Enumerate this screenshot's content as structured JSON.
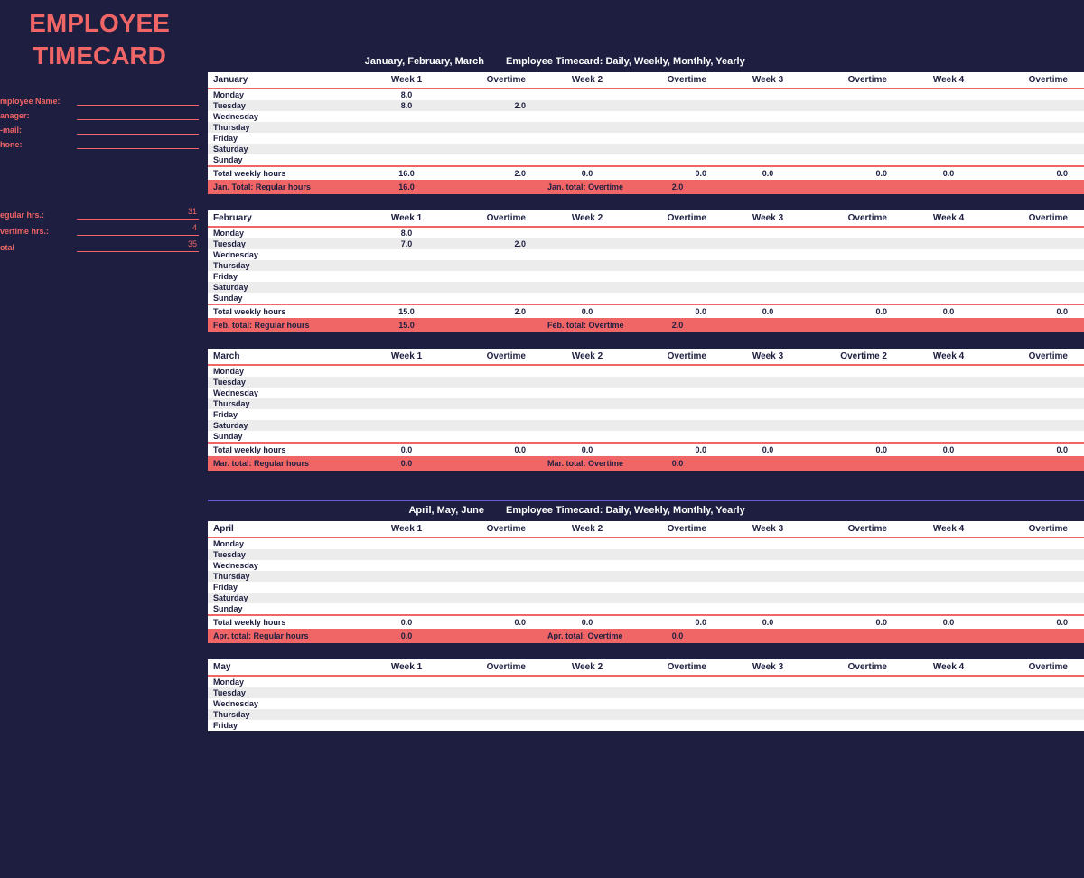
{
  "title": {
    "line1": "EMPLOYEE",
    "line2": "TIMECARD"
  },
  "sidebar": {
    "fields": [
      {
        "label": "mployee Name:"
      },
      {
        "label": "anager:"
      },
      {
        "label": "-mail:"
      },
      {
        "label": "hone:"
      }
    ],
    "totals": [
      {
        "label": "egular hrs.:",
        "value": "31"
      },
      {
        "label": "vertime hrs.:",
        "value": "4"
      },
      {
        "label": "otal",
        "value": "35"
      }
    ]
  },
  "sections": [
    {
      "heading_left": "January, February, March",
      "heading_right": "Employee Timecard: Daily, Weekly, Monthly, Yearly",
      "border_top": false
    },
    {
      "heading_left": "April, May, June",
      "heading_right": "Employee Timecard: Daily, Weekly, Monthly, Yearly",
      "border_top": true
    }
  ],
  "columns": [
    "Week 1",
    "Overtime",
    "Week 2",
    "Overtime",
    "Week 3",
    "Overtime",
    "Week 4",
    "Overtime"
  ],
  "columns_march": [
    "Week 1",
    "Overtime",
    "Week 2",
    "Overtime",
    "Week 3",
    "Overtime  2",
    "Week 4",
    "Overtime"
  ],
  "days": [
    "Monday",
    "Tuesday",
    "Wednesday",
    "Thursday",
    "Friday",
    "Saturday",
    "Sunday"
  ],
  "total_label": "Total weekly hours",
  "months": [
    {
      "section": 0,
      "name": "January",
      "cols": "columns",
      "rows": [
        [
          "8.0",
          "",
          "",
          "",
          "",
          "",
          "",
          ""
        ],
        [
          "8.0",
          "2.0",
          "",
          "",
          "",
          "",
          "",
          ""
        ],
        [
          "",
          "",
          "",
          "",
          "",
          "",
          "",
          ""
        ],
        [
          "",
          "",
          "",
          "",
          "",
          "",
          "",
          ""
        ],
        [
          "",
          "",
          "",
          "",
          "",
          "",
          "",
          ""
        ],
        [
          "",
          "",
          "",
          "",
          "",
          "",
          "",
          ""
        ],
        [
          "",
          "",
          "",
          "",
          "",
          "",
          "",
          ""
        ]
      ],
      "totals": [
        "16.0",
        "2.0",
        "0.0",
        "0.0",
        "0.0",
        "0.0",
        "0.0",
        "0.0"
      ],
      "grand_reg_label": "Jan. Total: Regular hours",
      "grand_reg_val": "16.0",
      "grand_ot_label": "Jan. total: Overtime",
      "grand_ot_val": "2.0"
    },
    {
      "section": 0,
      "name": "February",
      "cols": "columns",
      "rows": [
        [
          "8.0",
          "",
          "",
          "",
          "",
          "",
          "",
          ""
        ],
        [
          "7.0",
          "2.0",
          "",
          "",
          "",
          "",
          "",
          ""
        ],
        [
          "",
          "",
          "",
          "",
          "",
          "",
          "",
          ""
        ],
        [
          "",
          "",
          "",
          "",
          "",
          "",
          "",
          ""
        ],
        [
          "",
          "",
          "",
          "",
          "",
          "",
          "",
          ""
        ],
        [
          "",
          "",
          "",
          "",
          "",
          "",
          "",
          ""
        ],
        [
          "",
          "",
          "",
          "",
          "",
          "",
          "",
          ""
        ]
      ],
      "totals": [
        "15.0",
        "2.0",
        "0.0",
        "0.0",
        "0.0",
        "0.0",
        "0.0",
        "0.0"
      ],
      "grand_reg_label": "Feb. total: Regular hours",
      "grand_reg_val": "15.0",
      "grand_ot_label": "Feb. total: Overtime",
      "grand_ot_val": "2.0"
    },
    {
      "section": 0,
      "name": "March",
      "cols": "columns_march",
      "rows": [
        [
          "",
          "",
          "",
          "",
          "",
          "",
          "",
          ""
        ],
        [
          "",
          "",
          "",
          "",
          "",
          "",
          "",
          ""
        ],
        [
          "",
          "",
          "",
          "",
          "",
          "",
          "",
          ""
        ],
        [
          "",
          "",
          "",
          "",
          "",
          "",
          "",
          ""
        ],
        [
          "",
          "",
          "",
          "",
          "",
          "",
          "",
          ""
        ],
        [
          "",
          "",
          "",
          "",
          "",
          "",
          "",
          ""
        ],
        [
          "",
          "",
          "",
          "",
          "",
          "",
          "",
          ""
        ]
      ],
      "totals": [
        "0.0",
        "0.0",
        "0.0",
        "0.0",
        "0.0",
        "0.0",
        "0.0",
        "0.0"
      ],
      "grand_reg_label": "Mar. total: Regular hours",
      "grand_reg_val": "0.0",
      "grand_ot_label": "Mar. total: Overtime",
      "grand_ot_val": "0.0"
    },
    {
      "section": 1,
      "name": "April",
      "cols": "columns",
      "rows": [
        [
          "",
          "",
          "",
          "",
          "",
          "",
          "",
          ""
        ],
        [
          "",
          "",
          "",
          "",
          "",
          "",
          "",
          ""
        ],
        [
          "",
          "",
          "",
          "",
          "",
          "",
          "",
          ""
        ],
        [
          "",
          "",
          "",
          "",
          "",
          "",
          "",
          ""
        ],
        [
          "",
          "",
          "",
          "",
          "",
          "",
          "",
          ""
        ],
        [
          "",
          "",
          "",
          "",
          "",
          "",
          "",
          ""
        ],
        [
          "",
          "",
          "",
          "",
          "",
          "",
          "",
          ""
        ]
      ],
      "totals": [
        "0.0",
        "0.0",
        "0.0",
        "0.0",
        "0.0",
        "0.0",
        "0.0",
        "0.0"
      ],
      "grand_reg_label": "Apr. total: Regular hours",
      "grand_reg_val": "0.0",
      "grand_ot_label": "Apr. total: Overtime",
      "grand_ot_val": "0.0"
    },
    {
      "section": 1,
      "name": "May",
      "cols": "columns",
      "rows": [
        [
          "",
          "",
          "",
          "",
          "",
          "",
          "",
          ""
        ],
        [
          "",
          "",
          "",
          "",
          "",
          "",
          "",
          ""
        ],
        [
          "",
          "",
          "",
          "",
          "",
          "",
          "",
          ""
        ],
        [
          "",
          "",
          "",
          "",
          "",
          "",
          "",
          ""
        ],
        [
          "",
          "",
          "",
          "",
          "",
          "",
          "",
          ""
        ]
      ],
      "totals": null,
      "grand_reg_label": "",
      "grand_reg_val": "",
      "grand_ot_label": "",
      "grand_ot_val": "",
      "partial": true
    }
  ]
}
